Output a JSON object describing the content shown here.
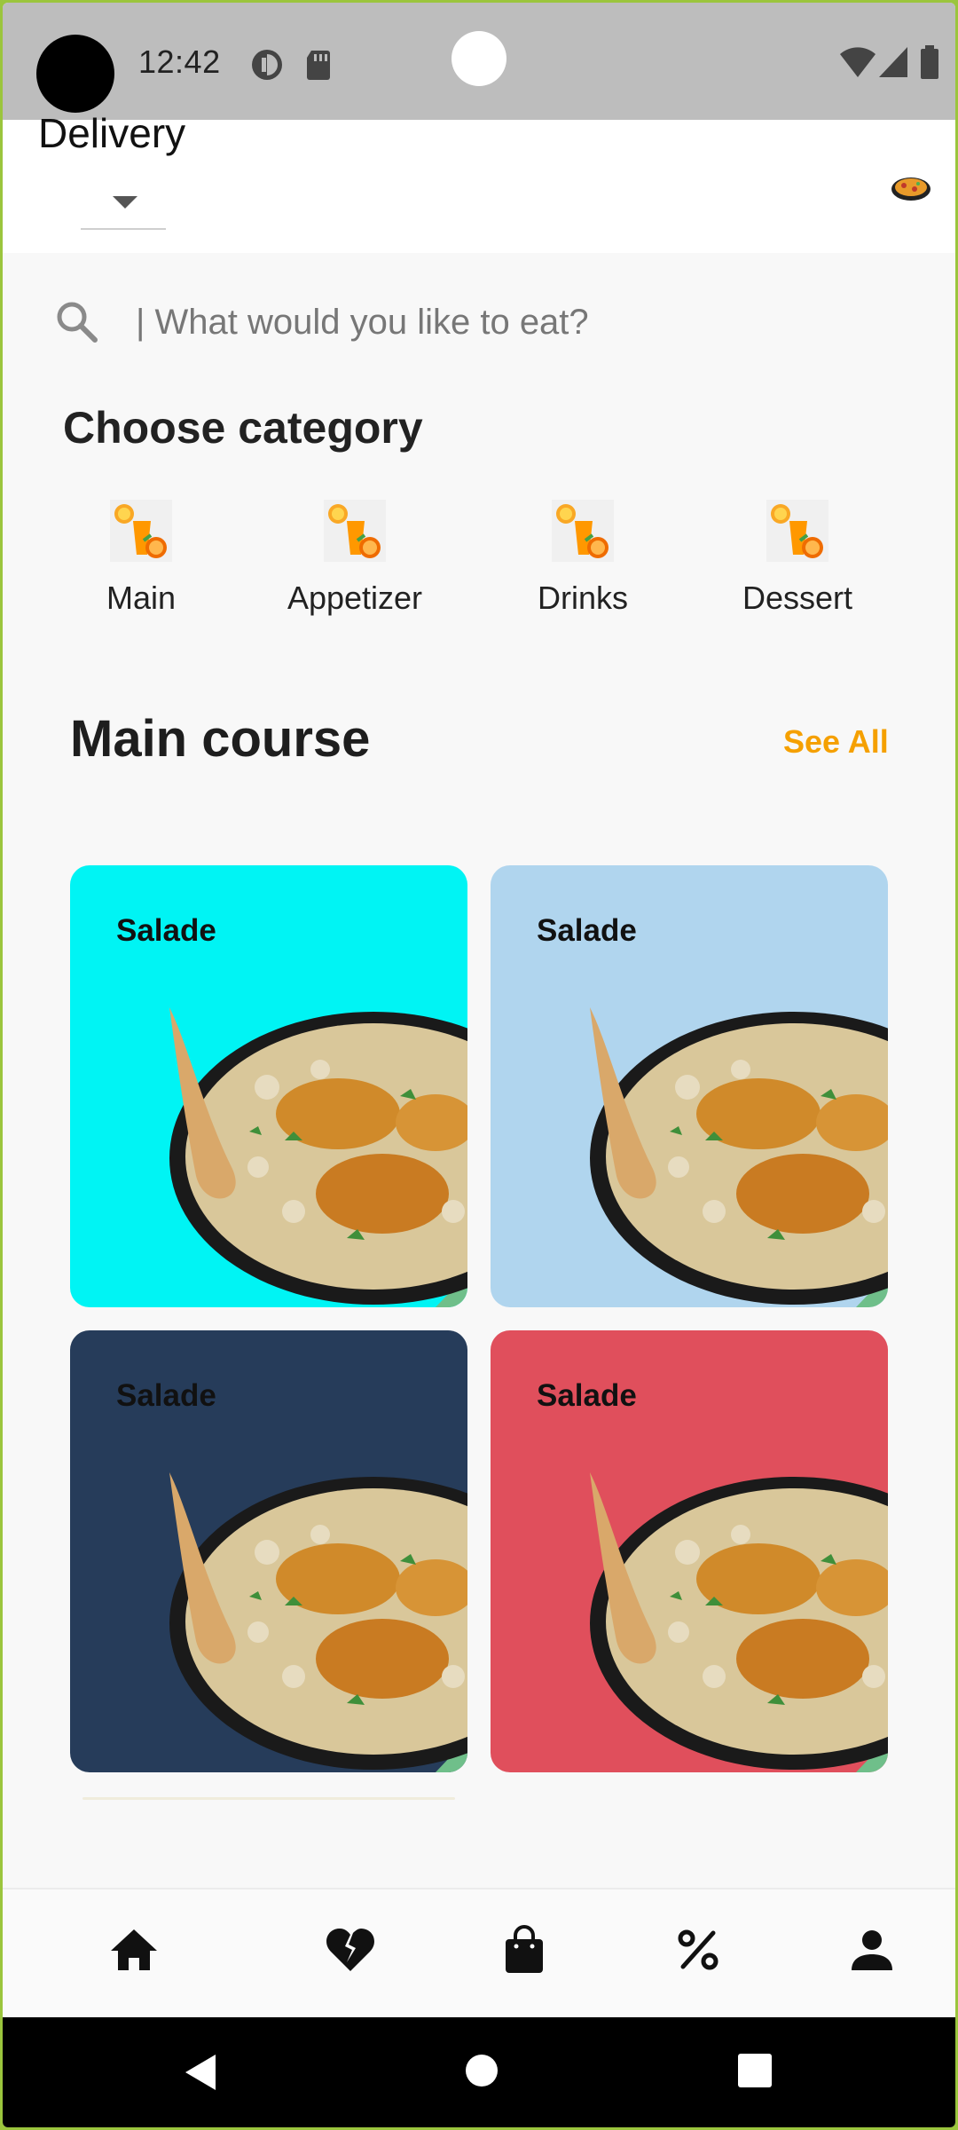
{
  "status_bar": {
    "time": "12:42"
  },
  "app_bar": {
    "title": "Delivery"
  },
  "search": {
    "placeholder": "| What would you like to eat?"
  },
  "categories_section": {
    "title": "Choose category",
    "items": [
      {
        "label": "Main",
        "icon": "orange-juice-icon"
      },
      {
        "label": "Appetizer",
        "icon": "orange-juice-icon"
      },
      {
        "label": "Drinks",
        "icon": "orange-juice-icon"
      },
      {
        "label": "Dessert",
        "icon": "orange-juice-icon"
      }
    ]
  },
  "main_course": {
    "title": "Main course",
    "see_all": "See All",
    "cards": [
      {
        "label": "Salade",
        "bg": "#00f4f4"
      },
      {
        "label": "Salade",
        "bg": "#b0d5ee"
      },
      {
        "label": "Salade",
        "bg": "#263c5a"
      },
      {
        "label": "Salade",
        "bg": "#e04f5c"
      }
    ]
  },
  "bottom_nav": [
    "home-icon",
    "broken-heart-icon",
    "shopping-bag-icon",
    "percent-icon",
    "person-icon"
  ],
  "colors": {
    "accent": "#f5a000",
    "text": "#1e1e1e"
  }
}
